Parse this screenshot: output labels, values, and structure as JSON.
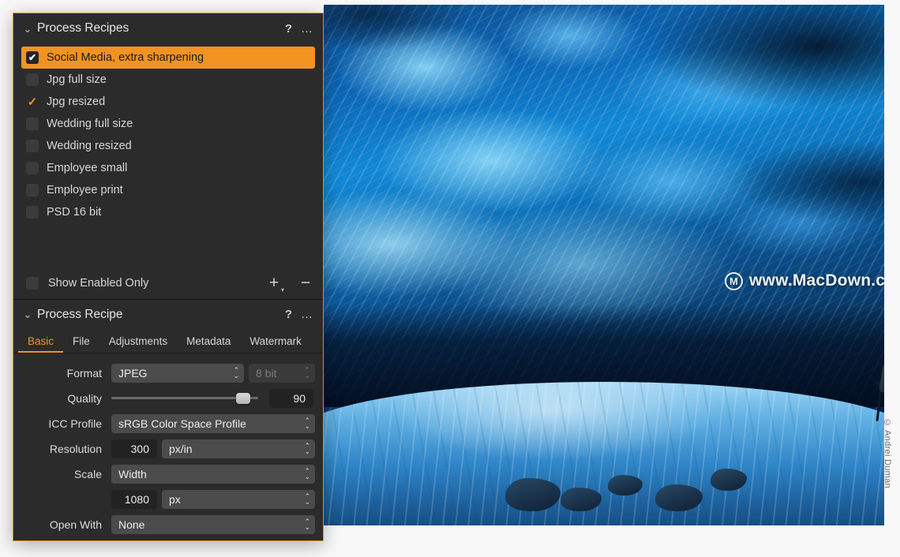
{
  "colors": {
    "accent": "#f29321",
    "panel_bg": "#2b2b2b",
    "select_bg": "#4b4b4b",
    "field_bg": "#222222"
  },
  "recipes_panel": {
    "title": "Process Recipes",
    "help_icon": "?",
    "more_icon": "…",
    "collapse_icon": "⌄",
    "items": [
      {
        "label": "Social Media, extra sharpening",
        "checked": true,
        "selected": true,
        "check_glyph": "✔"
      },
      {
        "label": "Jpg full size",
        "checked": false,
        "selected": false,
        "check_glyph": ""
      },
      {
        "label": "Jpg resized",
        "checked": true,
        "selected": false,
        "check_glyph": "✓"
      },
      {
        "label": "Wedding full size",
        "checked": false,
        "selected": false,
        "check_glyph": ""
      },
      {
        "label": "Wedding resized",
        "checked": false,
        "selected": false,
        "check_glyph": ""
      },
      {
        "label": "Employee small",
        "checked": false,
        "selected": false,
        "check_glyph": ""
      },
      {
        "label": "Employee print",
        "checked": false,
        "selected": false,
        "check_glyph": ""
      },
      {
        "label": "PSD 16 bit",
        "checked": false,
        "selected": false,
        "check_glyph": ""
      }
    ],
    "show_enabled_only": {
      "label": "Show Enabled Only",
      "checked": false
    },
    "add_button": "+",
    "add_button_caret": "▾",
    "remove_button": "−"
  },
  "recipe_panel": {
    "title": "Process Recipe",
    "help_icon": "?",
    "more_icon": "…",
    "collapse_icon": "⌄",
    "tabs": [
      {
        "label": "Basic",
        "active": true
      },
      {
        "label": "File",
        "active": false
      },
      {
        "label": "Adjustments",
        "active": false
      },
      {
        "label": "Metadata",
        "active": false
      },
      {
        "label": "Watermark",
        "active": false
      }
    ],
    "fields": {
      "format": {
        "label": "Format",
        "value": "JPEG",
        "bit_depth": "8 bit",
        "bit_depth_disabled": true
      },
      "quality": {
        "label": "Quality",
        "value": "90",
        "slider_percent": 90
      },
      "icc_profile": {
        "label": "ICC Profile",
        "value": "sRGB Color Space Profile"
      },
      "resolution": {
        "label": "Resolution",
        "value": "300",
        "unit": "px/in"
      },
      "scale": {
        "label": "Scale",
        "mode": "Width",
        "value": "1080",
        "unit": "px"
      },
      "open_with": {
        "label": "Open With",
        "value": "None"
      }
    },
    "stepper_up": "⌃",
    "stepper_down": "⌄"
  },
  "photo": {
    "watermark_text": "www.MacDown.com",
    "watermark_logo": "M",
    "copyright": "© Andrei Duman"
  }
}
